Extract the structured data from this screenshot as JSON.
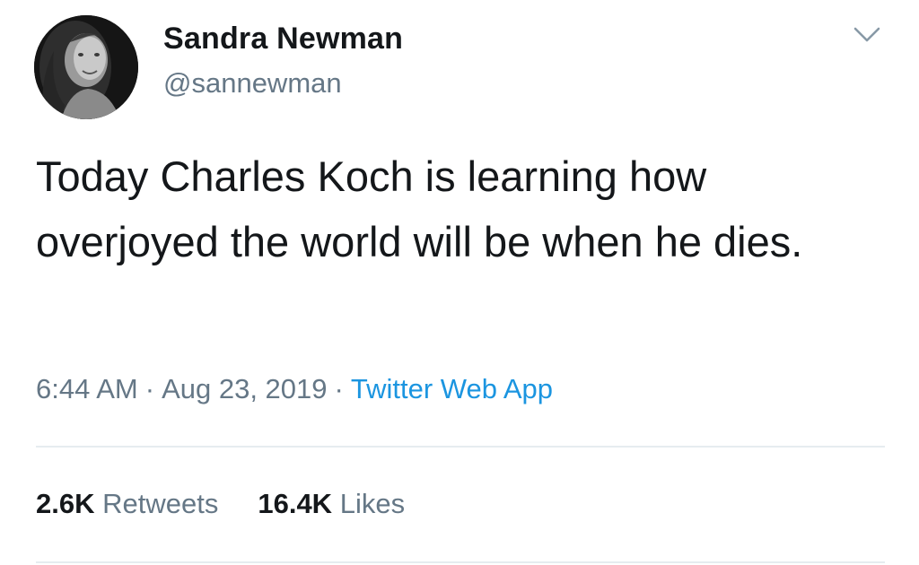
{
  "user": {
    "display_name": "Sandra Newman",
    "handle": "@sannewman"
  },
  "tweet": {
    "text": "Today Charles Koch is learning how overjoyed the world will be when he dies.",
    "time": "6:44 AM",
    "separator": "·",
    "date": "Aug 23, 2019",
    "source": "Twitter Web App"
  },
  "stats": {
    "retweets_count": "2.6K",
    "retweets_label": "Retweets",
    "likes_count": "16.4K",
    "likes_label": "Likes"
  },
  "icons": {
    "caret": "chevron-down-icon"
  },
  "colors": {
    "text": "#14171a",
    "secondary": "#657786",
    "link": "#1b95e0",
    "divider": "#e6ecf0"
  }
}
